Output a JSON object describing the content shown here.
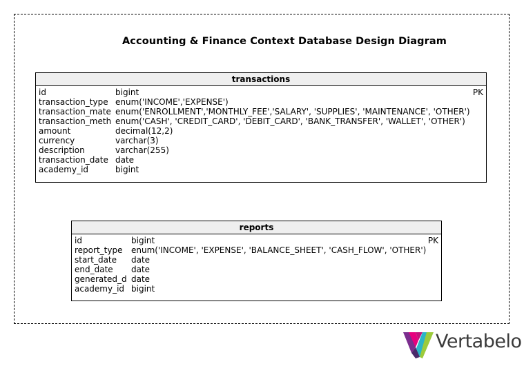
{
  "diagram": {
    "title": "Accounting & Finance Context Database Design Diagram"
  },
  "tables": [
    {
      "name": "transactions",
      "columns": [
        {
          "name": "id",
          "type": "bigint",
          "key": "PK"
        },
        {
          "name": "transaction_type",
          "type": "enum('INCOME','EXPENSE')",
          "key": ""
        },
        {
          "name": "transaction_mate",
          "type": "enum('ENROLLMENT','MONTHLY_FEE','SALARY', 'SUPPLIES', 'MAINTENANCE', 'OTHER')",
          "key": ""
        },
        {
          "name": "transaction_meth",
          "type": "enum('CASH', 'CREDIT_CARD', 'DEBIT_CARD', 'BANK_TRANSFER', 'WALLET', 'OTHER')",
          "key": ""
        },
        {
          "name": "amount",
          "type": "decimal(12,2)",
          "key": ""
        },
        {
          "name": "currency",
          "type": "varchar(3)",
          "key": ""
        },
        {
          "name": "description",
          "type": "varchar(255)",
          "key": ""
        },
        {
          "name": "transaction_date",
          "type": "date",
          "key": ""
        },
        {
          "name": "academy_id",
          "type": "bigint",
          "key": ""
        }
      ]
    },
    {
      "name": "reports",
      "columns": [
        {
          "name": "id",
          "type": "bigint",
          "key": "PK"
        },
        {
          "name": "report_type",
          "type": "enum('INCOME', 'EXPENSE', 'BALANCE_SHEET', 'CASH_FLOW', 'OTHER')",
          "key": ""
        },
        {
          "name": "start_date",
          "type": "date",
          "key": ""
        },
        {
          "name": "end_date",
          "type": "date",
          "key": ""
        },
        {
          "name": "generated_d",
          "type": "date",
          "key": ""
        },
        {
          "name": "academy_id",
          "type": "bigint",
          "key": ""
        }
      ]
    }
  ],
  "logo": {
    "text": "Vertabelo",
    "colors": [
      "#3a3a3a",
      "#e6007e",
      "#7b2d8e",
      "#2bb5c7",
      "#9ccb3b"
    ]
  }
}
